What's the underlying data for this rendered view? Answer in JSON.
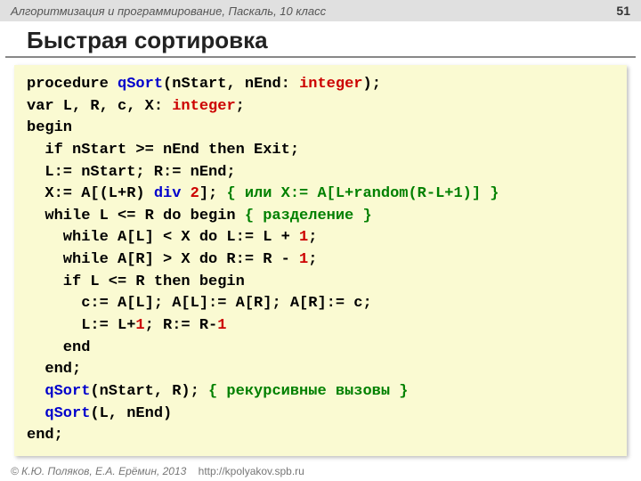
{
  "header": {
    "course": "Алгоритмизация и программирование, Паскаль, 10 класс",
    "page": "51"
  },
  "title": "Быстрая сортировка",
  "code": {
    "l1a": "procedure ",
    "l1b": "qSort",
    "l1c": "(nStart, nEnd: ",
    "l1d": "integer",
    "l1e": ");",
    "l2a": "var L, R, c, X: ",
    "l2b": "integer",
    "l2c": ";",
    "l3": "begin",
    "l4": "if nStart >= nEnd then Exit;",
    "l5": "L:= nStart; R:= nEnd;",
    "l6a": "X:= A[(L+R) ",
    "l6b": "div ",
    "l6c": "2",
    "l6d": "]; ",
    "l6e": "{ или X:= A[L+random(R-L+1)] }",
    "l7a": "while L <= R do begin ",
    "l7b": "{ разделение }",
    "l8a": "while A[L] < X do L:= L + ",
    "l8b": "1",
    "l8c": ";",
    "l9a": "while A[R] > X do R:= R - ",
    "l9b": "1",
    "l9c": ";",
    "l10": "if L <= R then begin",
    "l11": "c:= A[L]; A[L]:= A[R]; A[R]:= c;",
    "l12a": "L:= L+",
    "l12b": "1",
    "l12c": "; R:= R-",
    "l12d": "1",
    "l13": "end",
    "l14": "end;",
    "l15a": "qSort",
    "l15b": "(nStart, R); ",
    "l15c": "{ рекурсивные вызовы }",
    "l16a": "qSort",
    "l16b": "(L, nEnd)",
    "l17": "end;"
  },
  "footer": {
    "authors": "© К.Ю. Поляков, Е.А. Ерёмин, 2013",
    "url": "http://kpolyakov.spb.ru"
  }
}
